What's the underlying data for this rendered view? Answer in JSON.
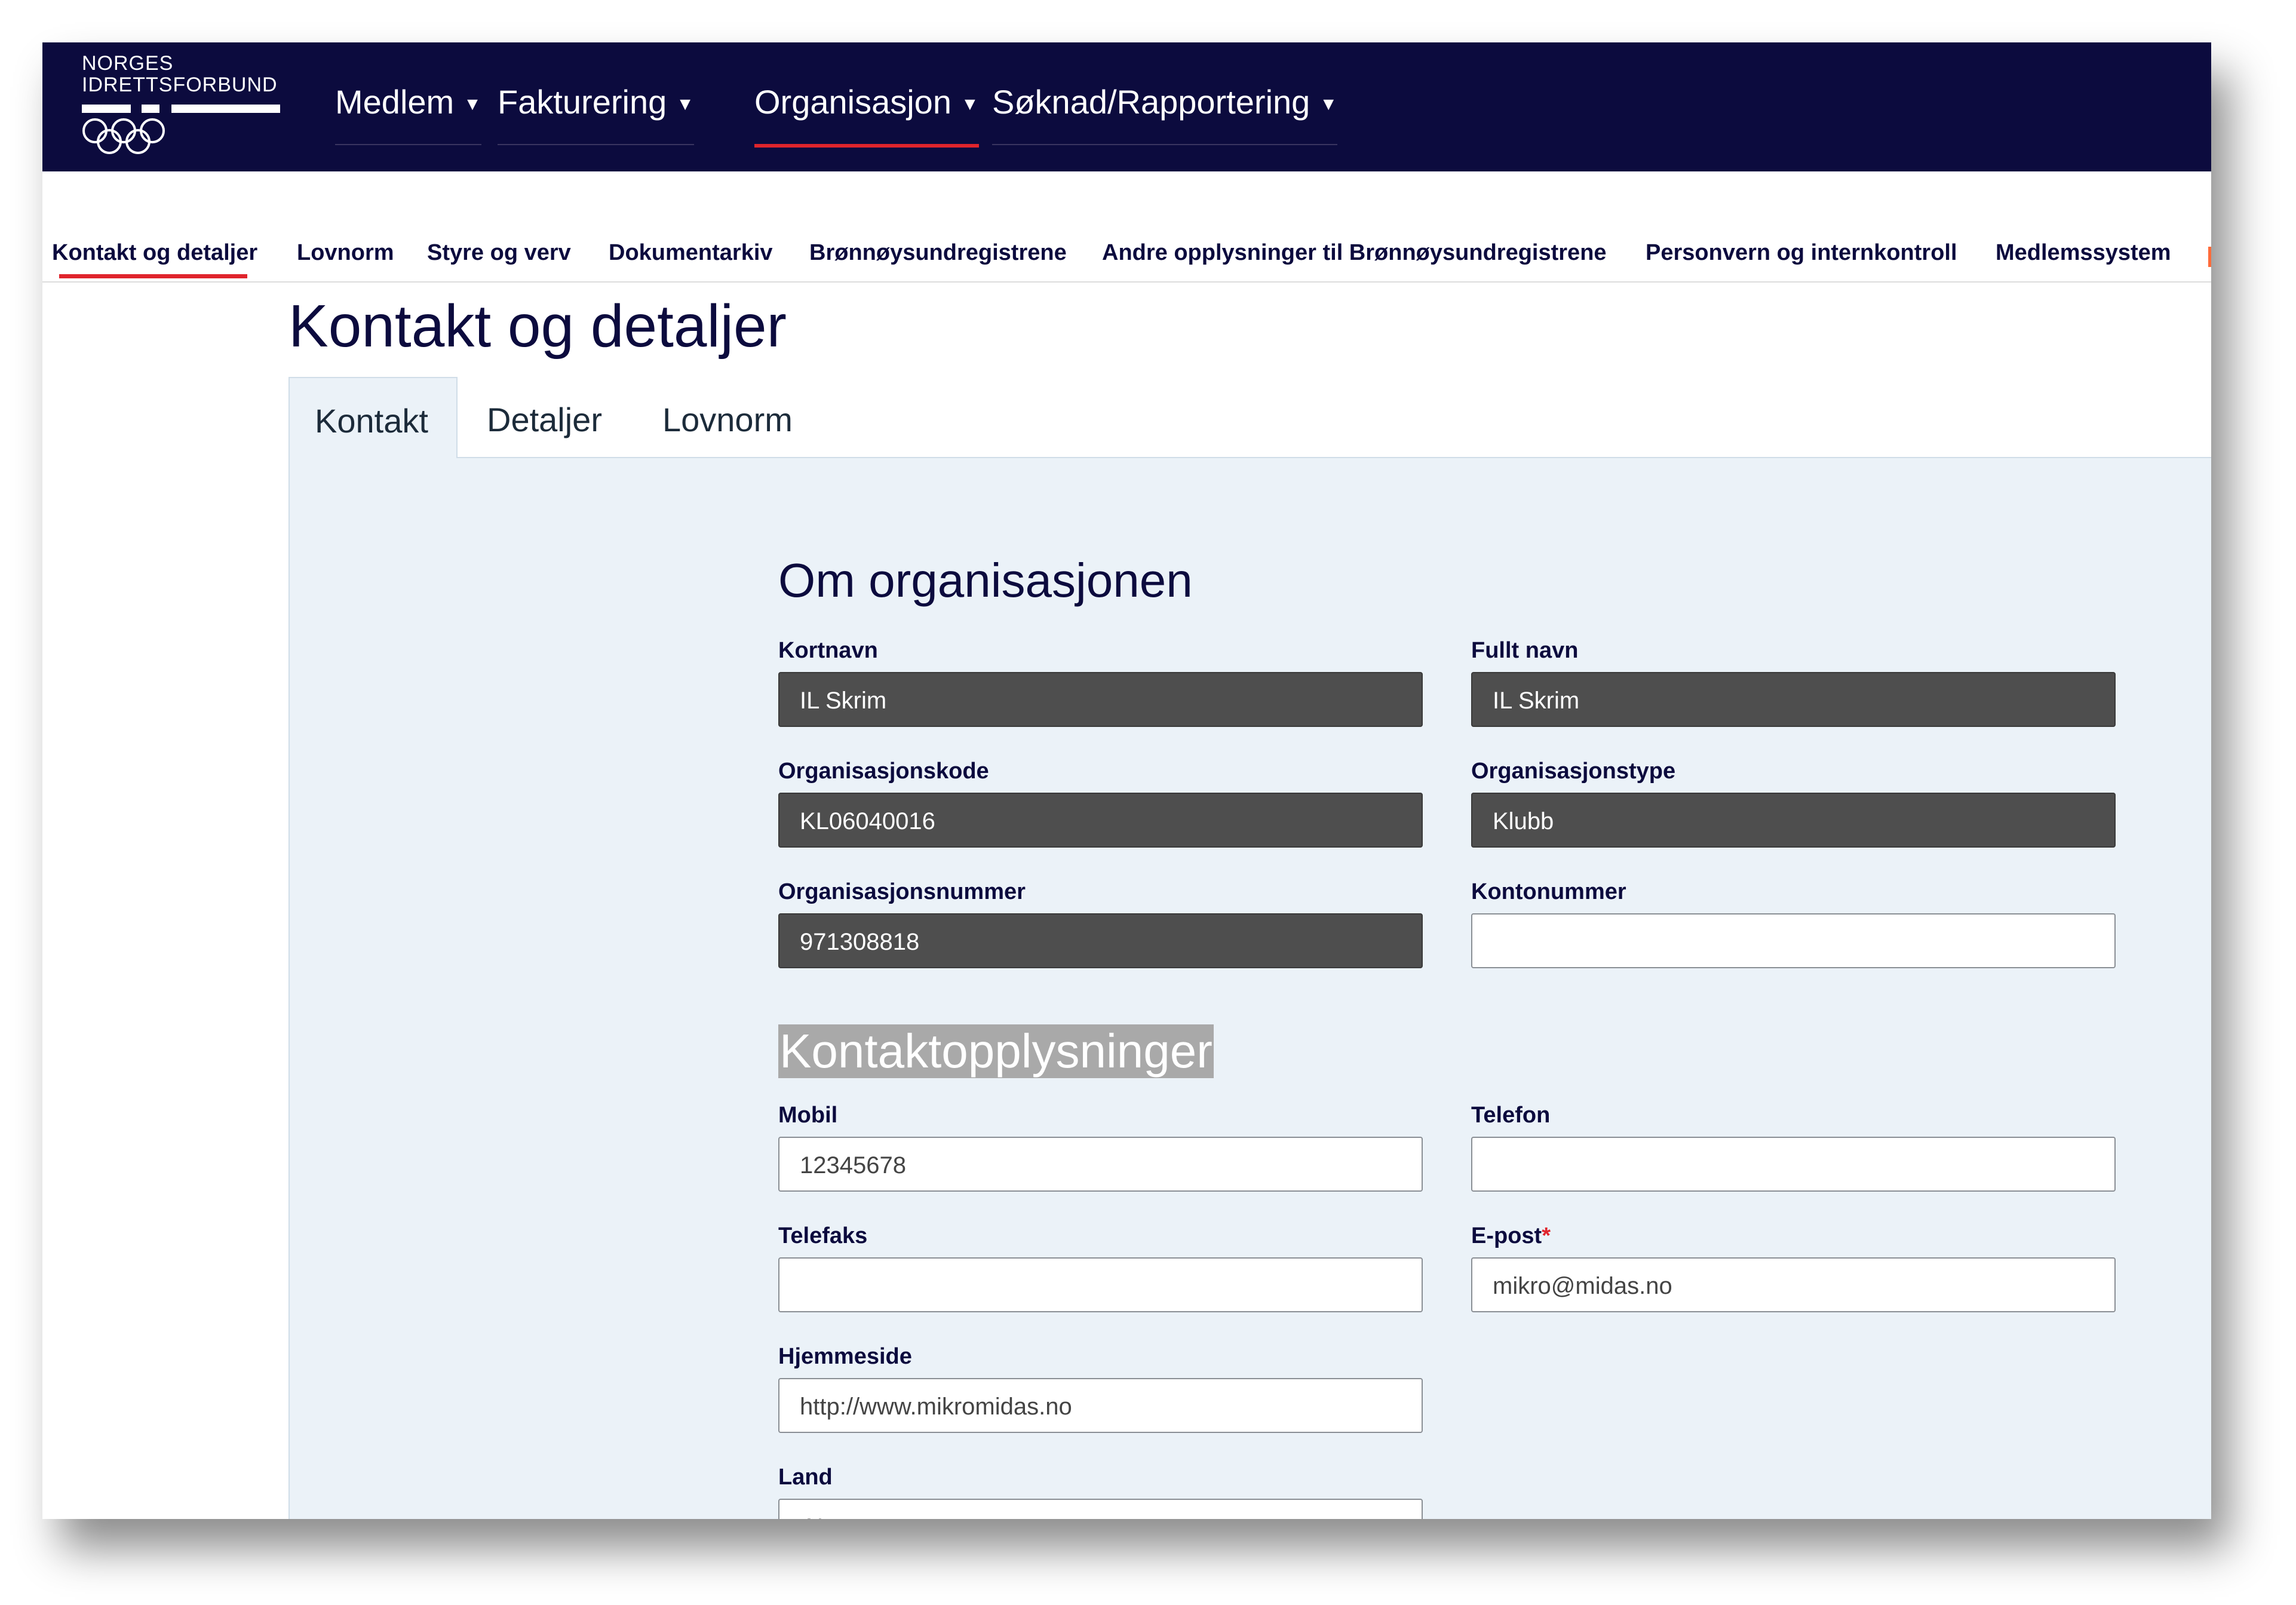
{
  "logo": {
    "line1": "NORGES",
    "line2": "IDRETTSFORBUND"
  },
  "main_menu": [
    {
      "label": "Medlem"
    },
    {
      "label": "Fakturering"
    },
    {
      "label": "Organisasjon",
      "active": true
    },
    {
      "label": "Søknad/Rapportering"
    }
  ],
  "sub_nav": [
    {
      "label": "Kontakt og detaljer",
      "active": true
    },
    {
      "label": "Lovnorm"
    },
    {
      "label": "Styre og verv"
    },
    {
      "label": "Dokumentarkiv"
    },
    {
      "label": "Brønnøysundregistrene"
    },
    {
      "label": "Andre opplysninger til Brønnøysundregistrene"
    },
    {
      "label": "Personvern og internkontroll"
    },
    {
      "label": "Medlemssystem"
    }
  ],
  "page": {
    "title": "Kontakt og detaljer",
    "tabs": [
      {
        "label": "Kontakt",
        "active": true
      },
      {
        "label": "Detaljer"
      },
      {
        "label": "Lovnorm"
      }
    ]
  },
  "org_section": {
    "title": "Om organisasjonen",
    "kortnavn": {
      "label": "Kortnavn",
      "value": "IL Skrim"
    },
    "fullt_navn": {
      "label": "Fullt navn",
      "value": "IL Skrim"
    },
    "org_kode": {
      "label": "Organisasjonskode",
      "value": "KL06040016"
    },
    "org_type": {
      "label": "Organisasjonstype",
      "value": "Klubb"
    },
    "org_nummer": {
      "label": "Organisasjonsnummer",
      "value": "971308818"
    },
    "kontonummer": {
      "label": "Kontonummer",
      "value": ""
    }
  },
  "contact_section": {
    "title": "Kontaktopplysninger",
    "mobil": {
      "label": "Mobil",
      "value": "12345678"
    },
    "telefon": {
      "label": "Telefon",
      "value": ""
    },
    "telefaks": {
      "label": "Telefaks",
      "value": ""
    },
    "epost": {
      "label": "E-post",
      "required_mark": "*",
      "value": "mikro@midas.no"
    },
    "hjemmeside": {
      "label": "Hjemmeside",
      "value": "http://www.mikromidas.no"
    },
    "land": {
      "label": "Land",
      "value": "Norge"
    }
  },
  "colors": {
    "nav_bg": "#0c0b3e",
    "accent_red": "#e0242c",
    "panel_bg": "#ebf2f8",
    "readonly_field": "#4e4e4e"
  },
  "icons": {
    "caret": "caret-down-icon",
    "select_chevron": "chevron-down-icon",
    "logo_rings": "olympic-rings-icon"
  }
}
